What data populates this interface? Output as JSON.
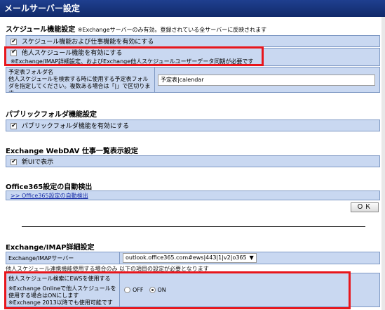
{
  "title": "メールサーバー設定",
  "schedule": {
    "heading": "スケジュール機能設定",
    "note": "※Exchangeサーバーのみ有効。登録されている全サーバーに反映されます",
    "enable_label": "スケジュール機能および仕事機能を有効にする",
    "enable_checked": true,
    "others_label": "他人スケジュール機能を有効にする",
    "others_note": "※Exchange/IMAP詳細設定、およびExchange他人スケジュールユーザーデータ同期が必要です",
    "others_checked": true,
    "folder_label": "予定表フォルダ名\n他人スケジュールを検索する時に使用する予定表フォルダを指定してください。複数ある場合は「|」で区切ります。",
    "folder_value": "予定表|calendar"
  },
  "public_folder": {
    "heading": "パブリックフォルダ機能設定",
    "enable_label": "パブリックフォルダ機能を有効にする",
    "enable_checked": true
  },
  "webdav": {
    "heading": "Exchange WebDAV 仕事一覧表示設定",
    "newui_label": "新UIで表示",
    "newui_checked": true
  },
  "office365": {
    "heading": "Office365設定の自動検出",
    "link": ">> Office365設定の自動検出"
  },
  "ok_label": "ＯＫ",
  "imap": {
    "heading": "Exchange/IMAP詳細設定",
    "server_label": "Exchange/IMAPサーバー",
    "server_value": "outlook.office365.com#ews|443|1|v2|o365",
    "partial_text": "他人スケジュール連携機能使用する場合のみ 以下の項目の設定が必要となります",
    "ews_label": "他人スケジュール検索にEWSを使用する",
    "ews_note": "※Exchange Onlineで他人スケジュールを使用する場合はONにします\n※Exchange 2013以降でも使用可能です",
    "off_label": "OFF",
    "on_label": "ON",
    "selected": "ON"
  }
}
